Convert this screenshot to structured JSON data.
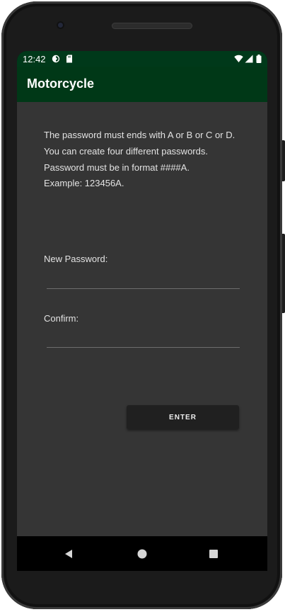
{
  "status_bar": {
    "time": "12:42",
    "icons": [
      "sync-icon",
      "sd-card-icon",
      "wifi-icon",
      "signal-icon",
      "battery-icon"
    ]
  },
  "app_bar": {
    "title": "Motorcycle"
  },
  "instructions": {
    "line1": "The password must ends with A or B or C or D.",
    "line2": "You can create four different passwords.",
    "line3": "Password must be in format ####A.",
    "line4": "Example:  123456A."
  },
  "form": {
    "new_password_label": "New Password:",
    "new_password_value": "",
    "confirm_label": "Confirm:",
    "confirm_value": "",
    "enter_label": "ENTER"
  },
  "nav": {
    "buttons": [
      "back-icon",
      "home-icon",
      "recents-icon"
    ]
  },
  "colors": {
    "status_bar": "#00391a",
    "app_bar": "#003817",
    "content_bg": "#353535",
    "button_bg": "#202020"
  }
}
